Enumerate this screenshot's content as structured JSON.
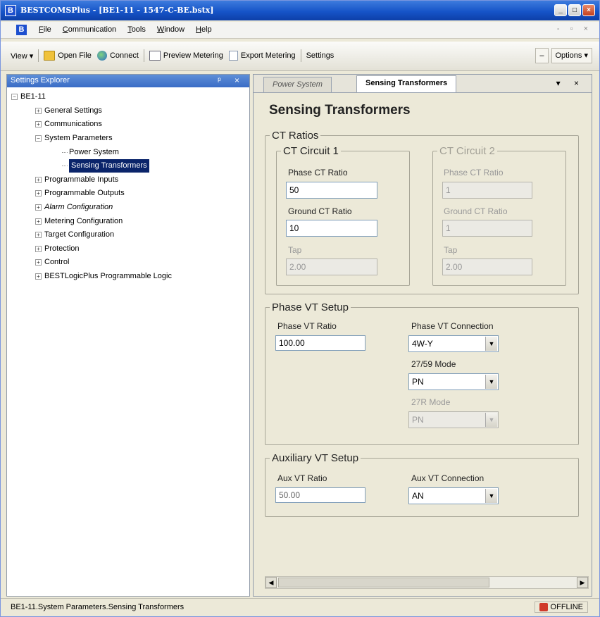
{
  "window": {
    "title": "BESTCOMSPlus - [BE1-11 - 1547-C-BE.bstx]",
    "app_icon": "B",
    "buttons": [
      "_",
      "□",
      "×"
    ]
  },
  "menubar": {
    "items": [
      "File",
      "Communication",
      "Tools",
      "Window",
      "Help"
    ],
    "mdi_controls": "- ▫ ×"
  },
  "toolbar": {
    "view": "View ▾",
    "open_file": "Open File",
    "connect": "Connect",
    "preview_metering": "Preview Metering",
    "export_metering": "Export Metering",
    "settings": "Settings",
    "options": "Options ▾"
  },
  "explorer": {
    "title": "Settings Explorer",
    "controls": "ᵖ ×",
    "root": "BE1-11",
    "nodes": [
      {
        "label": "General Settings",
        "expander": "+"
      },
      {
        "label": "Communications",
        "expander": "+"
      },
      {
        "label": "System Parameters",
        "expander": "−"
      },
      {
        "label": "Power System"
      },
      {
        "label": "Sensing Transformers"
      },
      {
        "label": "Programmable Inputs",
        "expander": "+"
      },
      {
        "label": "Programmable Outputs",
        "expander": "+"
      },
      {
        "label": "Alarm Configuration",
        "expander": "+"
      },
      {
        "label": "Metering Configuration",
        "expander": "+"
      },
      {
        "label": "Target Configuration",
        "expander": "+"
      },
      {
        "label": "Protection",
        "expander": "+"
      },
      {
        "label": "Control",
        "expander": "+"
      },
      {
        "label": "BESTLogicPlus Programmable Logic",
        "expander": "+"
      }
    ]
  },
  "tabs": {
    "inactive": "Power System",
    "active": "Sensing Transformers",
    "controls": "▾ ×"
  },
  "page": {
    "title": "Sensing Transformers"
  },
  "ct": {
    "legend": "CT Ratios",
    "circuit1": {
      "legend": "CT Circuit 1",
      "phase_label": "Phase CT Ratio",
      "phase_value": "50",
      "ground_label": "Ground CT Ratio",
      "ground_value": "10",
      "tap_label": "Tap",
      "tap_value": "2.00"
    },
    "circuit2": {
      "legend": "CT Circuit 2",
      "phase_label": "Phase CT Ratio",
      "phase_value": "1",
      "ground_label": "Ground CT Ratio",
      "ground_value": "1",
      "tap_label": "Tap",
      "tap_value": "2.00"
    }
  },
  "phase_vt": {
    "legend": "Phase VT Setup",
    "ratio_label": "Phase VT Ratio",
    "ratio_value": "100.00",
    "connection_label": "Phase VT Connection",
    "connection_value": "4W-Y",
    "mode_27_59_label": "27/59 Mode",
    "mode_27_59_value": "PN",
    "mode_27r_label": "27R Mode",
    "mode_27r_value": "PN"
  },
  "aux_vt": {
    "legend": "Auxiliary VT Setup",
    "ratio_label": "Aux VT Ratio",
    "ratio_value": "50.00",
    "connection_label": "Aux VT Connection",
    "connection_value": "AN"
  },
  "status": {
    "path": "BE1-11.System Parameters.Sensing Transformers",
    "connection": "OFFLINE"
  },
  "arrow_glyph": "▼",
  "scroll": {
    "left": "◀",
    "right": "▶"
  }
}
